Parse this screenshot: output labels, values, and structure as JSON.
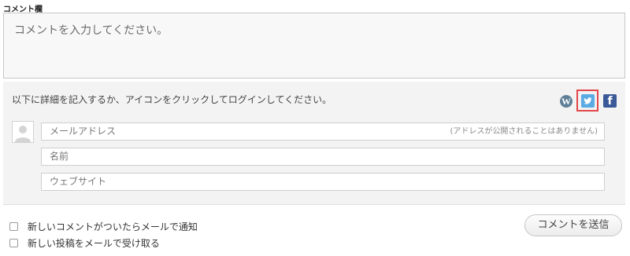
{
  "form": {
    "section_label": "コメント欄",
    "comment_placeholder": "コメントを入力してください。",
    "instructions": "以下に詳細を記入するか、アイコンをクリックしてログインしてください。",
    "services": {
      "wordpress_icon": "wordpress-icon",
      "twitter_icon": "twitter-icon",
      "facebook_icon": "facebook-icon",
      "wordpress_glyph": "W",
      "facebook_glyph": "f",
      "highlight_color": "#e2474a"
    },
    "email_placeholder": "メールアドレス",
    "email_hint": "(アドレスが公開されることはありません)",
    "name_placeholder": "名前",
    "website_placeholder": "ウェブサイト",
    "notify_comments_label": "新しいコメントがついたらメールで通知",
    "notify_posts_label": "新しい投稿をメールで受け取る",
    "submit_label": "コメントを送信"
  }
}
